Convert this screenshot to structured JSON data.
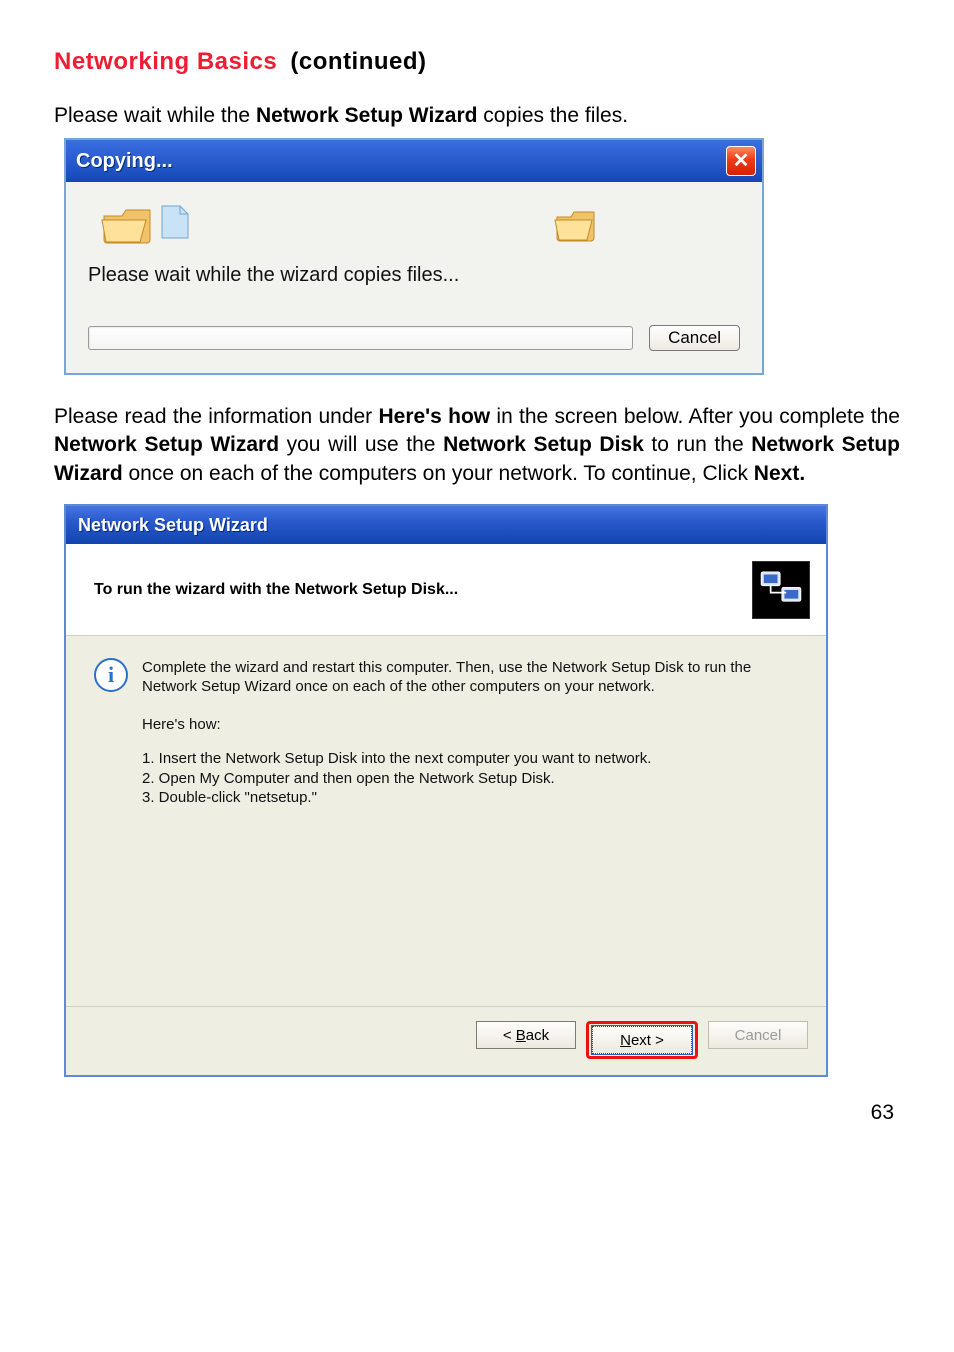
{
  "heading": {
    "red": "Networking Basics",
    "black": "(continued)"
  },
  "intro": {
    "pre": "Please wait while the ",
    "bold": "Network Setup Wizard",
    "post": " copies the files."
  },
  "copying_dialog": {
    "title": "Copying...",
    "close_symbol": "✕",
    "message": "Please wait while the wizard copies files...",
    "cancel": "Cancel"
  },
  "midtext": {
    "t1": "Please read the information under ",
    "b1": "Here's how",
    "t2": " in the screen below.  After you complete the ",
    "b2": "Network Setup Wizard",
    "t3": " you will use the ",
    "b3": "Network Setup Disk",
    "t4": " to run the ",
    "b4": "Network Setup Wizard",
    "t5": " once on each of the computers on your network.  To continue, Click ",
    "b5": "Next."
  },
  "wizard_dialog": {
    "title": "Network Setup Wizard",
    "header": "To run the wizard with the Network Setup Disk...",
    "info": "Complete the wizard and restart this computer. Then, use the Network Setup Disk to run the Network Setup Wizard once on each of the other computers on your network.",
    "heres_how_label": "Here's how:",
    "steps": [
      "1.  Insert the Network Setup Disk into the next computer you want to network.",
      "2.  Open My Computer and then open the Network Setup Disk.",
      "3.  Double-click \"netsetup.\""
    ],
    "buttons": {
      "back": "< Back",
      "next": "Next >",
      "cancel": "Cancel"
    }
  },
  "page_number": "63"
}
